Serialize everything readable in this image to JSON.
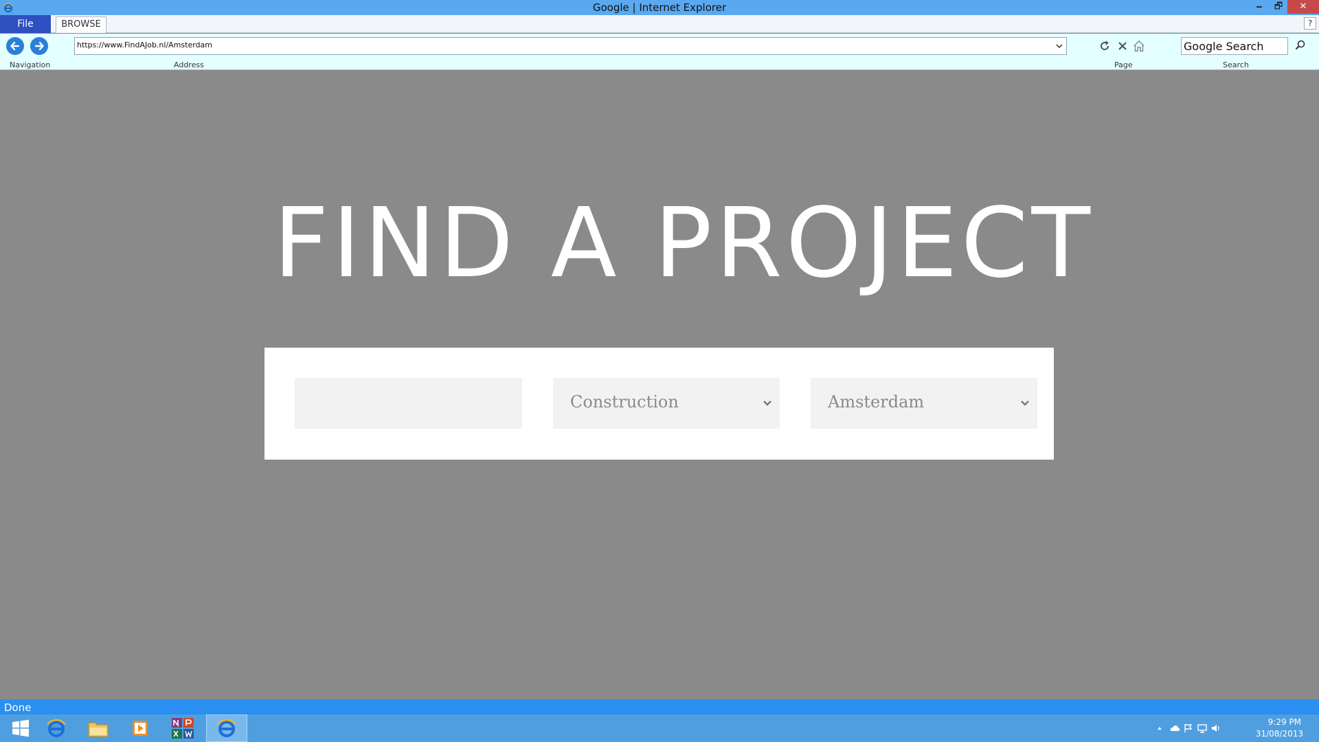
{
  "window": {
    "title": "Google | Internet Explorer",
    "minimize_symbol": "🗕",
    "maximize_symbol": "🗗",
    "close_symbol": "✕"
  },
  "ribbon": {
    "file_tab": "File",
    "browse_tab": "BROWSE",
    "help_symbol": "?"
  },
  "toolbar": {
    "navigation_label": "Navigation",
    "address_label": "Address",
    "page_label": "Page",
    "search_label": "Search",
    "address_value": "https://www.FindAJob.nl/Amsterdam",
    "search_value": "Google Search"
  },
  "page": {
    "heading": "FIND A PROJECT",
    "keyword_value": "",
    "category_selected": "Construction",
    "location_selected": "Amsterdam"
  },
  "status": {
    "text": "Done"
  },
  "taskbar": {
    "time": "9:29 PM",
    "date": "31/08/2013"
  },
  "colors": {
    "titlebar": "#5aa9f0",
    "file_tab": "#2e4fbf",
    "toolbar_bg": "#e4ffff",
    "page_bg": "#8a8a8a",
    "statusbar": "#2a8ff0",
    "taskbar": "#4f9fe0"
  },
  "icons": {
    "nav_back": "arrow-left-icon",
    "nav_forward": "arrow-right-icon",
    "refresh": "refresh-icon",
    "stop": "close-icon",
    "home": "home-icon",
    "search": "search-icon"
  }
}
